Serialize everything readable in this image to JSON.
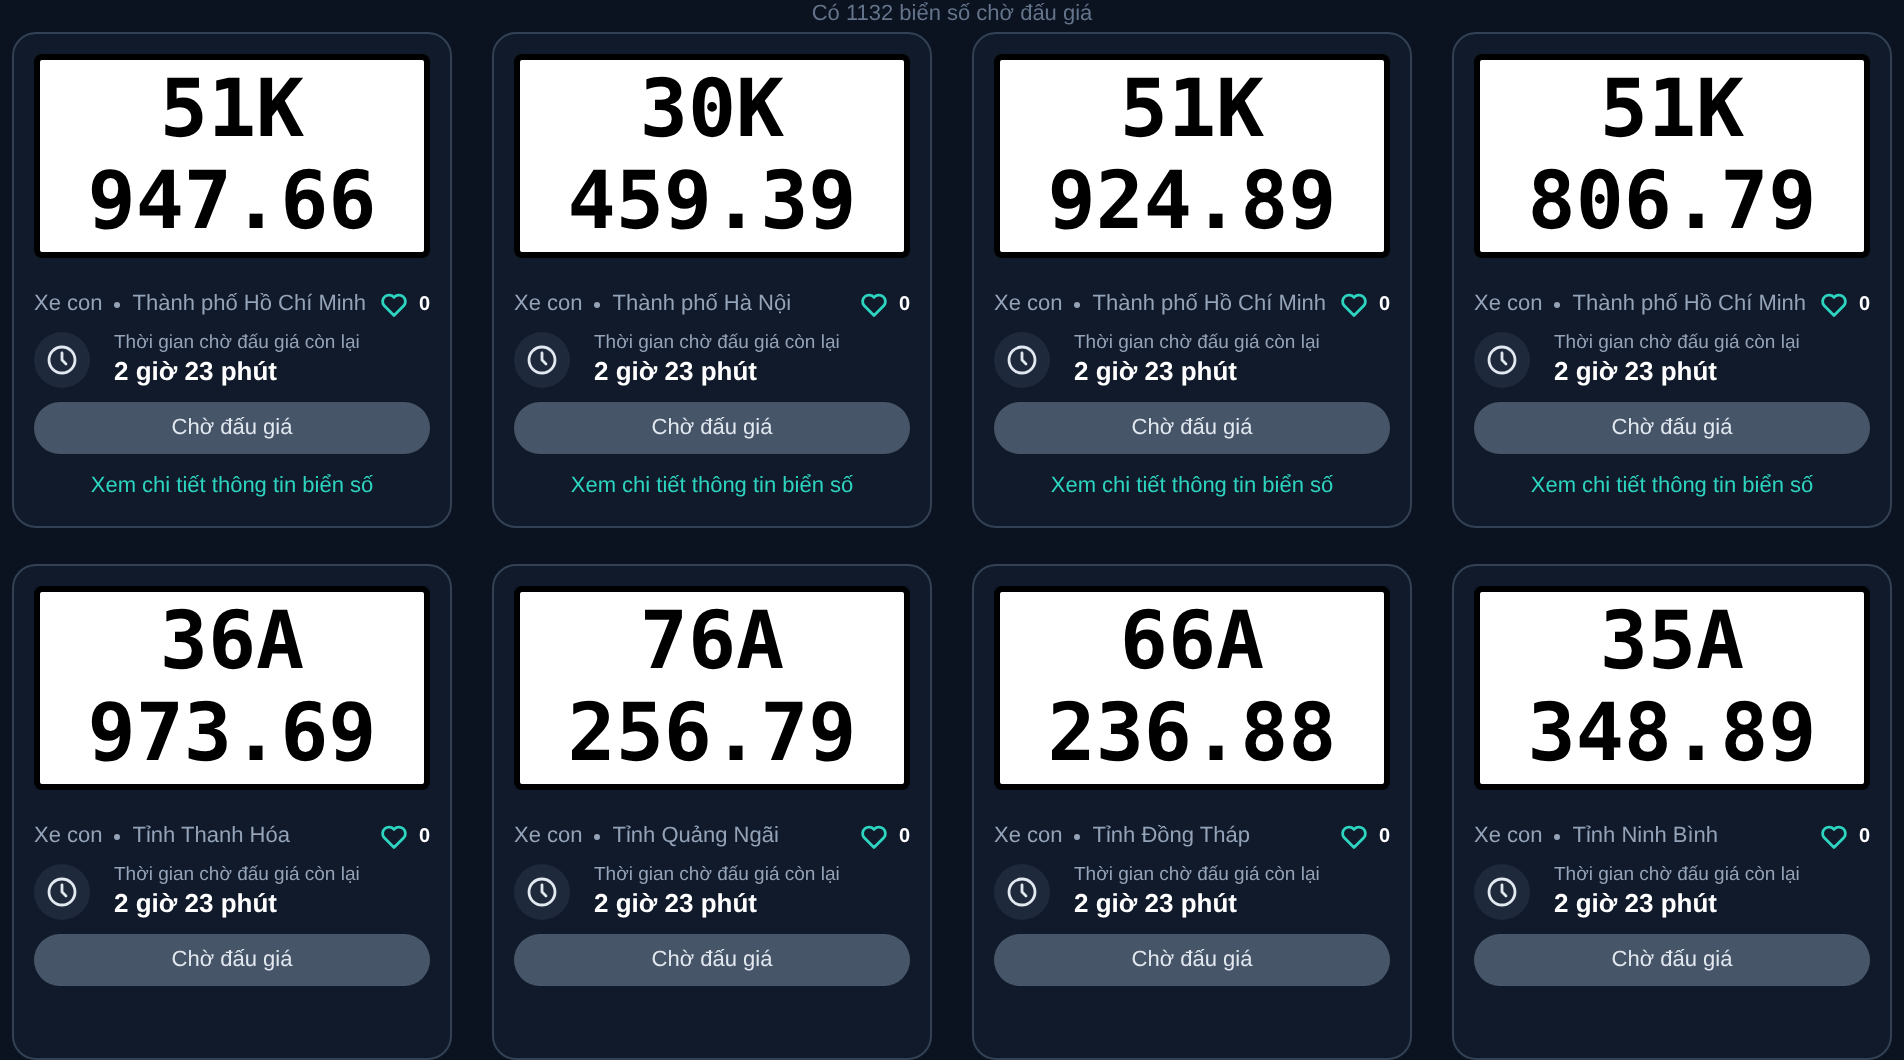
{
  "header": {
    "count_text": "Có 1132 biển số chờ đấu giá"
  },
  "plates": [
    {
      "line1": "51K",
      "line2": "947.66",
      "vehicle": "Xe con",
      "location": "Thành phố Hồ Chí Minh",
      "likes": "0",
      "liked": false,
      "time_label": "Thời gian chờ đấu giá còn lại",
      "time": "2 giờ 23 phút",
      "button": "Chờ đấu giá",
      "link": "Xem chi tiết thông tin biển số"
    },
    {
      "line1": "30K",
      "line2": "459.39",
      "vehicle": "Xe con",
      "location": "Thành phố Hà Nội",
      "likes": "0",
      "liked": false,
      "time_label": "Thời gian chờ đấu giá còn lại",
      "time": "2 giờ 23 phút",
      "button": "Chờ đấu giá",
      "link": "Xem chi tiết thông tin biển số"
    },
    {
      "line1": "51K",
      "line2": "924.89",
      "vehicle": "Xe con",
      "location": "Thành phố Hồ Chí Minh",
      "likes": "0",
      "liked": false,
      "time_label": "Thời gian chờ đấu giá còn lại",
      "time": "2 giờ 23 phút",
      "button": "Chờ đấu giá",
      "link": "Xem chi tiết thông tin biển số"
    },
    {
      "line1": "51K",
      "line2": "806.79",
      "vehicle": "Xe con",
      "location": "Thành phố Hồ Chí Minh",
      "likes": "0",
      "liked": false,
      "time_label": "Thời gian chờ đấu giá còn lại",
      "time": "2 giờ 23 phút",
      "button": "Chờ đấu giá",
      "link": "Xem chi tiết thông tin biển số"
    },
    {
      "line1": "36A",
      "line2": "973.69",
      "vehicle": "Xe con",
      "location": "Tỉnh Thanh Hóa",
      "likes": "0",
      "liked": false,
      "time_label": "Thời gian chờ đấu giá còn lại",
      "time": "2 giờ 23 phút",
      "button": "Chờ đấu giá"
    },
    {
      "line1": "76A",
      "line2": "256.79",
      "vehicle": "Xe con",
      "location": "Tỉnh Quảng Ngãi",
      "likes": "0",
      "liked": false,
      "time_label": "Thời gian chờ đấu giá còn lại",
      "time": "2 giờ 23 phút",
      "button": "Chờ đấu giá"
    },
    {
      "line1": "66A",
      "line2": "236.88",
      "vehicle": "Xe con",
      "location": "Tỉnh Đồng Tháp",
      "likes": "0",
      "liked": false,
      "time_label": "Thời gian chờ đấu giá còn lại",
      "time": "2 giờ 23 phút",
      "button": "Chờ đấu giá"
    },
    {
      "line1": "35A",
      "line2": "348.89",
      "vehicle": "Xe con",
      "location": "Tỉnh Ninh Bình",
      "likes": "0",
      "liked": false,
      "time_label": "Thời gian chờ đấu giá còn lại",
      "time": "2 giờ 23 phút",
      "button": "Chờ đấu giá"
    }
  ]
}
